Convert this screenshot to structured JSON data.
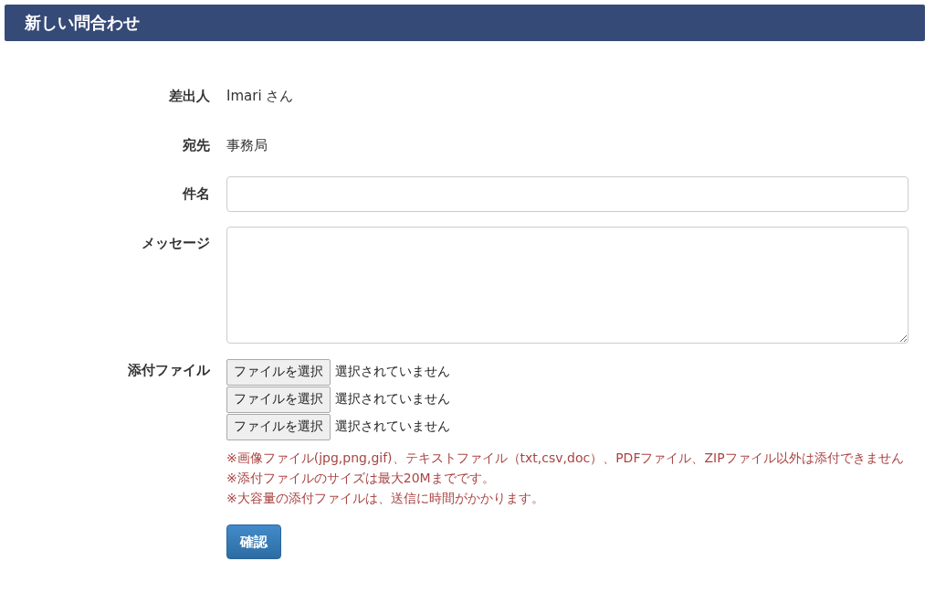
{
  "header": {
    "title": "新しい問合わせ"
  },
  "fields": [
    {
      "kind": "text",
      "label": "差出人",
      "value": "Imari さん"
    },
    {
      "kind": "text",
      "label": "宛先",
      "value": "事務局"
    },
    {
      "kind": "input",
      "label": "件名"
    },
    {
      "kind": "textarea",
      "label": "メッセージ"
    },
    {
      "kind": "files",
      "label": "添付ファイル",
      "files": [
        {
          "button": "ファイルを選択",
          "status": "選択されていません"
        },
        {
          "button": "ファイルを選択",
          "status": "選択されていません"
        },
        {
          "button": "ファイルを選択",
          "status": "選択されていません"
        }
      ],
      "notes": [
        "※画像ファイル(jpg,png,gif)、テキストファイル（txt,csv,doc）、PDFファイル、ZIPファイル以外は添付できません",
        "※添付ファイルのサイズは最大20Mまでです。",
        "※大容量の添付ファイルは、送信に時間がかかります。"
      ]
    }
  ],
  "submit": {
    "label": "確認"
  }
}
